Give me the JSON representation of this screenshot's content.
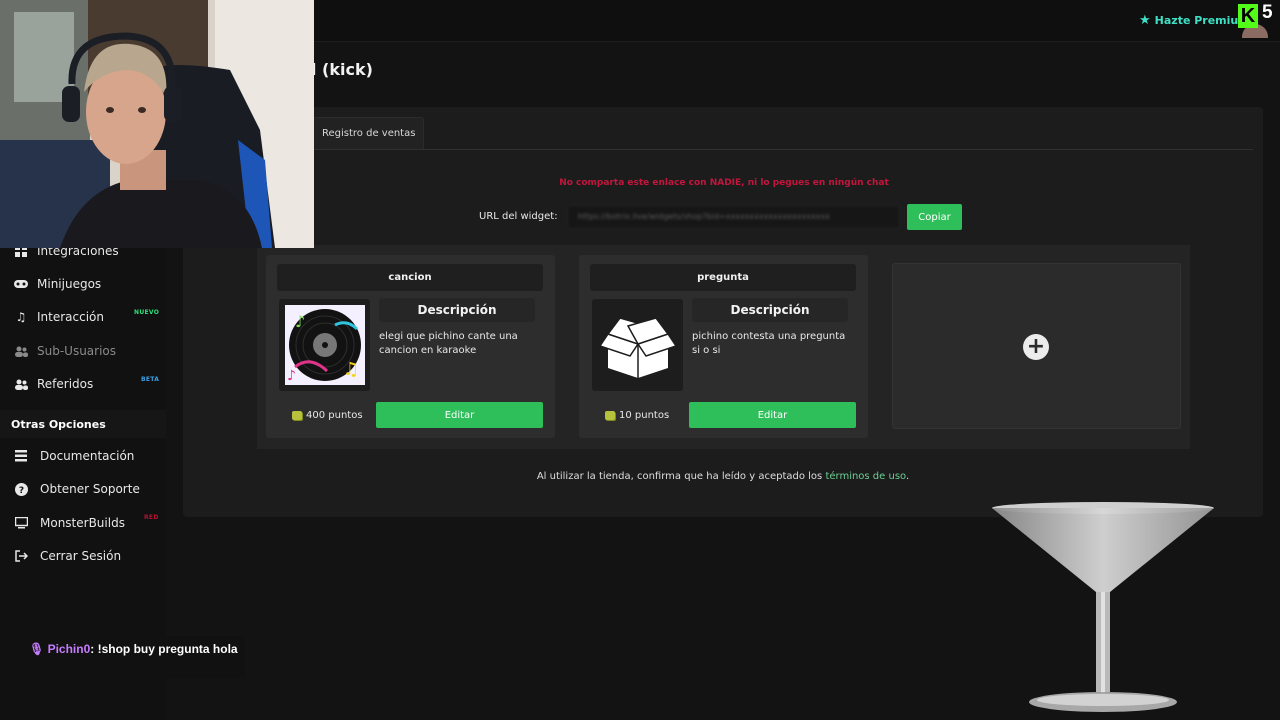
{
  "header": {
    "premium_label": "Hazte Premium",
    "avatar_badge": "K",
    "avatar_number": "5"
  },
  "page": {
    "title": "d (kick)"
  },
  "sidebar": {
    "items": [
      {
        "label": "Integraciones",
        "icon": "grid-icon"
      },
      {
        "label": "Minijuegos",
        "icon": "gamepad-icon"
      },
      {
        "label": "Interacción",
        "icon": "music-note-icon",
        "badge": "NUEVO"
      },
      {
        "label": "Sub-Usuarios",
        "icon": "users-icon"
      },
      {
        "label": "Referidos",
        "icon": "users-icon",
        "badge": "BETA"
      }
    ],
    "section_title": "Otras Opciones",
    "other_items": [
      {
        "label": "Documentación",
        "icon": "document-icon"
      },
      {
        "label": "Obtener Soporte",
        "icon": "help-icon"
      },
      {
        "label": "MonsterBuilds",
        "icon": "monitor-icon",
        "badge": "RED"
      },
      {
        "label": "Cerrar Sesión",
        "icon": "logout-icon"
      }
    ]
  },
  "tabs": [
    {
      "label": "Registro de ventas"
    }
  ],
  "widget": {
    "warning": "No comparta este enlace con NADIE, ni lo pegues en ningún chat",
    "url_label": "URL del widget:",
    "url_value": "https://botrix.live/widgets/shop?bid=xxxxxxxxxxxxxxxxxxxxxx",
    "copy_label": "Copiar"
  },
  "items": [
    {
      "title": "cancion",
      "description_heading": "Descripción",
      "description": "elegi que pichino cante una cancion en karaoke",
      "points": "400 puntos",
      "edit_label": "Editar",
      "image": "vinyl-record-icon"
    },
    {
      "title": "pregunta",
      "description_heading": "Descripción",
      "description": "pichino contesta una pregunta si o si",
      "points": "10 puntos",
      "edit_label": "Editar",
      "image": "open-box-icon"
    }
  ],
  "terms": {
    "prefix": "Al utilizar la tienda, confirma que ha leído y aceptado los ",
    "link": "términos de uso",
    "suffix": "."
  },
  "chat": {
    "username": "Pichin0",
    "message": ": !shop buy pregunta hola"
  },
  "colors": {
    "accent_green": "#2ebf5a",
    "warning_red": "#c4163d",
    "premium_teal": "#3fe0c5",
    "kick_green": "#53fc18"
  }
}
